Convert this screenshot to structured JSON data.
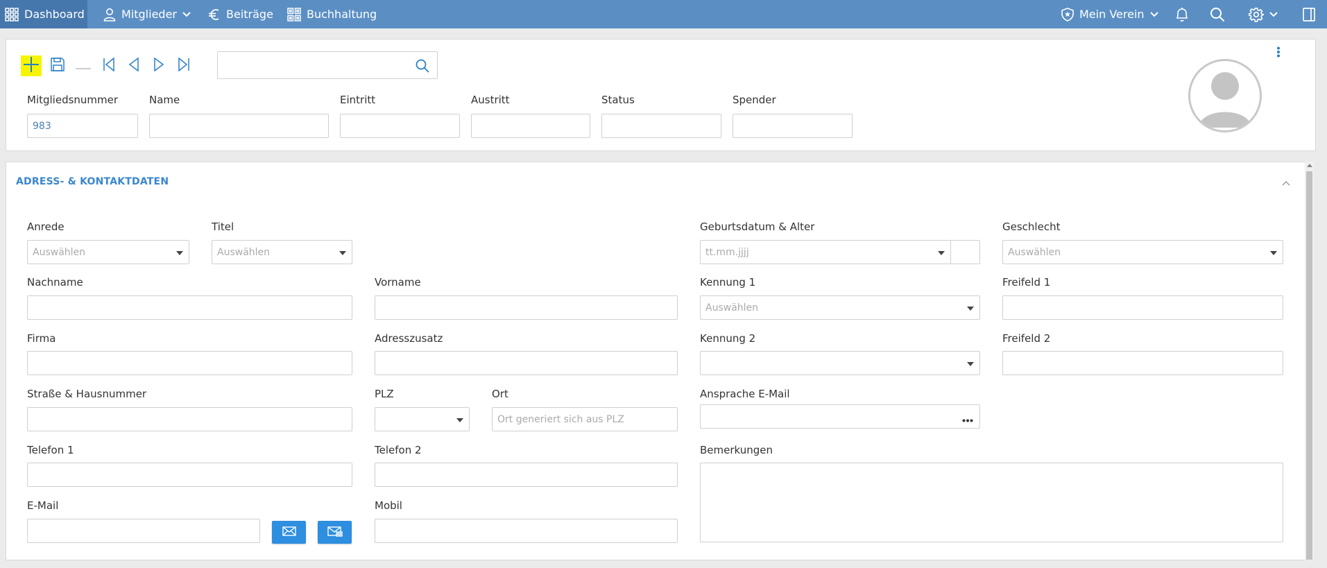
{
  "nav": {
    "dashboard": "Dashboard",
    "mitglieder": "Mitglieder",
    "beitraege": "Beiträge",
    "buchhaltung": "Buchhaltung",
    "verein": "Mein Verein"
  },
  "header": {
    "labels": {
      "mitgliedsnummer": "Mitgliedsnummer",
      "name": "Name",
      "eintritt": "Eintritt",
      "austritt": "Austritt",
      "status": "Status",
      "spender": "Spender"
    },
    "values": {
      "mitgliedsnummer": "983"
    },
    "search_value": ""
  },
  "section": {
    "title": "ADRESS- & KONTAKTDATEN"
  },
  "form": {
    "labels": {
      "anrede": "Anrede",
      "titel": "Titel",
      "geburtsdatum": "Geburtsdatum & Alter",
      "geschlecht": "Geschlecht",
      "nachname": "Nachname",
      "vorname": "Vorname",
      "kennung1": "Kennung 1",
      "freifeld1": "Freifeld 1",
      "firma": "Firma",
      "adresszusatz": "Adresszusatz",
      "kennung2": "Kennung 2",
      "freifeld2": "Freifeld 2",
      "strasse": "Straße & Hausnummer",
      "plz": "PLZ",
      "ort": "Ort",
      "ansprache_email": "Ansprache E-Mail",
      "telefon1": "Telefon 1",
      "telefon2": "Telefon 2",
      "bemerkungen": "Bemerkungen",
      "email": "E-Mail",
      "mobil": "Mobil"
    },
    "placeholders": {
      "select": "Auswählen",
      "date": "tt.mm.jjjj",
      "ort": "Ort generiert sich aus PLZ"
    }
  },
  "colors": {
    "nav_bg": "#5b8fc4",
    "nav_active": "#4677ac",
    "accent": "#3a86cc",
    "button_blue": "#2e8ee0",
    "highlight": "#f5f500"
  }
}
